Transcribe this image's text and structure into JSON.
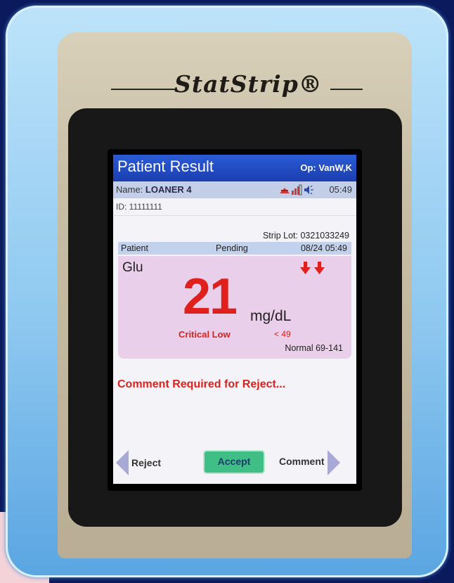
{
  "device": {
    "brand": "StatStrip®"
  },
  "screen": {
    "title": "Patient Result",
    "operator": "Op: VanW,K",
    "name_label": "Name:",
    "name_value": "LOANER 4",
    "time": "05:49",
    "id": "ID: 11111111",
    "strip_lot": "Strip Lot: 0321033249",
    "patient_bar": {
      "type": "Patient",
      "status": "Pending",
      "datetime": "08/24 05:49"
    },
    "result": {
      "analyte": "Glu",
      "value": "21",
      "unit": "mg/dL",
      "flag": "Critical Low",
      "limit": "< 49",
      "normal_range": "Normal 69-141",
      "arrow_icon": "double-down-arrow-icon",
      "critical_color": "#e0201c"
    },
    "message": "Comment Required for Reject...",
    "buttons": {
      "reject": "Reject",
      "accept": "Accept",
      "comment": "Comment"
    },
    "status_icons": [
      "alert-icon",
      "signal-icon",
      "speaker-icon"
    ]
  }
}
